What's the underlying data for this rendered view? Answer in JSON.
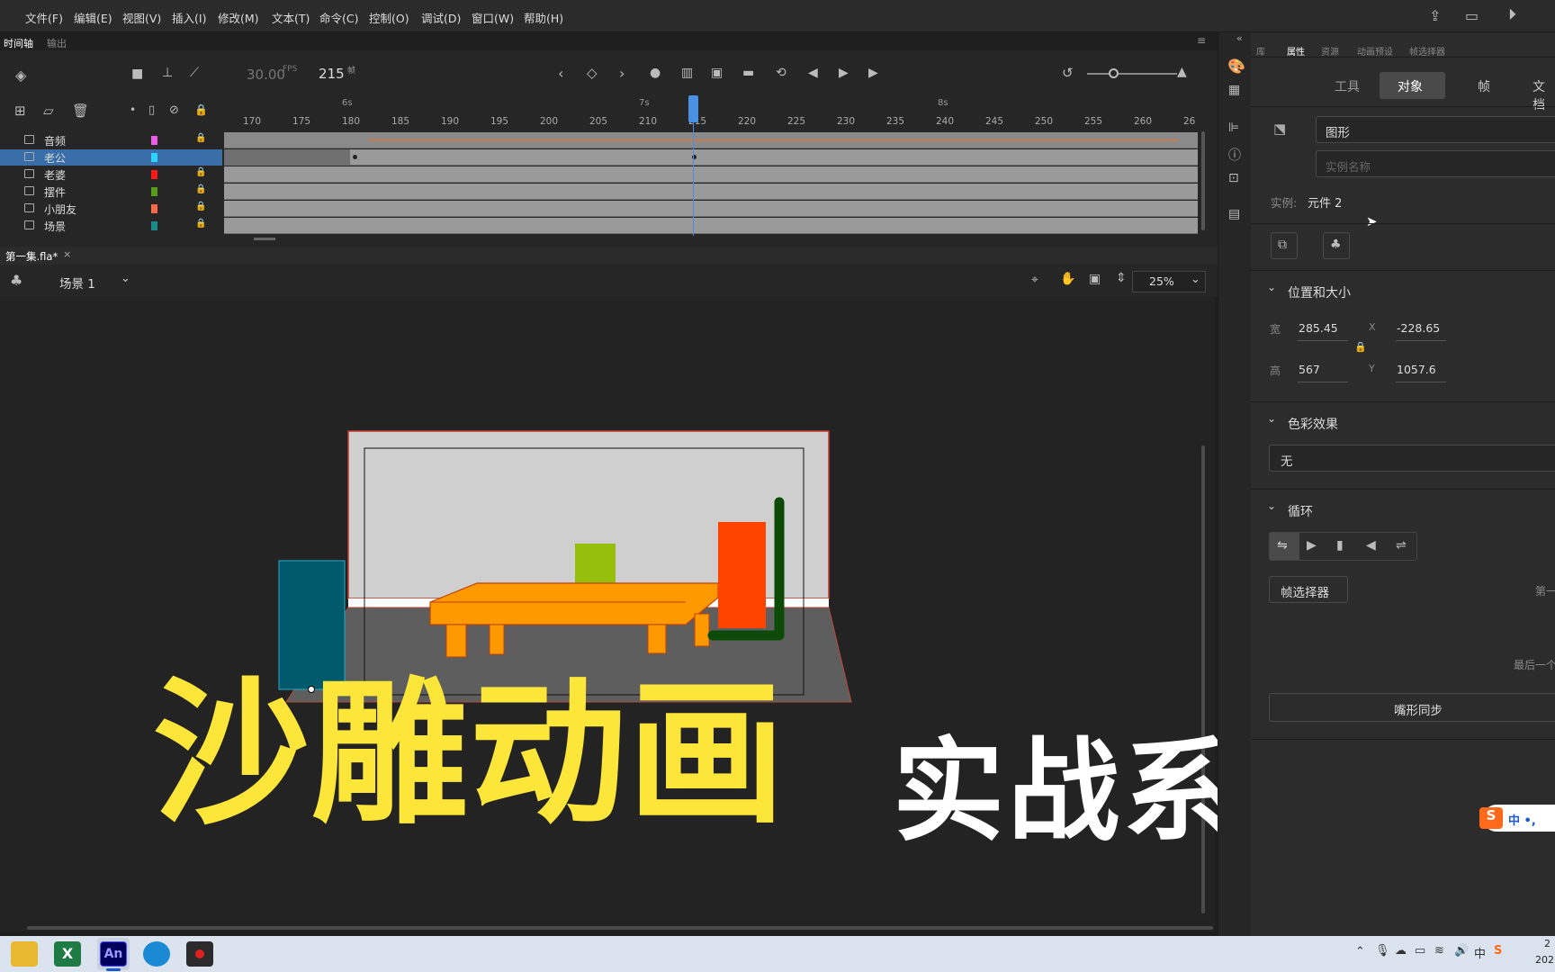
{
  "menu": [
    "文件(F)",
    "编辑(E)",
    "视图(V)",
    "插入(I)",
    "修改(M)",
    "文本(T)",
    "命令(C)",
    "控制(O)",
    "调试(D)",
    "窗口(W)",
    "帮助(H)"
  ],
  "timeline": {
    "tab_active": "时间轴",
    "tab_other": "输出",
    "fps": "30.00",
    "fps_unit": "FPS",
    "frame": "215",
    "frame_unit": "帧",
    "ticks": [
      "170",
      "175",
      "180",
      "185",
      "190",
      "195",
      "200",
      "205",
      "210",
      "215",
      "220",
      "225",
      "230",
      "235",
      "240",
      "245",
      "250",
      "255",
      "260",
      "26"
    ],
    "secs": [
      "6s",
      "7s",
      "8s"
    ],
    "layers": [
      {
        "name": "音频",
        "color": "#e85ce8"
      },
      {
        "name": "老公",
        "color": "#2ad4ff"
      },
      {
        "name": "老婆",
        "color": "#ff1a1a"
      },
      {
        "name": "摆件",
        "color": "#5a9a1a"
      },
      {
        "name": "小朋友",
        "color": "#ff6a4a"
      },
      {
        "name": "场景",
        "color": "#1a8a8a"
      }
    ]
  },
  "document": {
    "tab": "第一集.fla*",
    "scene": "场景 1",
    "zoom": "25%"
  },
  "props": {
    "tabs": [
      "库",
      "属性",
      "资源",
      "动画预设",
      "帧选择器"
    ],
    "subtabs": [
      "工具",
      "对象",
      "帧",
      "文档"
    ],
    "type": "图形",
    "instance_placeholder": "实例名称",
    "instance_label": "实例:",
    "instance_value": "元件 2",
    "pos_title": "位置和大小",
    "w_label": "宽",
    "w": "285.45",
    "x_label": "X",
    "x": "-228.65",
    "h_label": "高",
    "h": "567",
    "y_label": "Y",
    "y": "1057.6",
    "color_title": "色彩效果",
    "color_value": "无",
    "loop_title": "循环",
    "frame_picker": "帧选择器",
    "first_label": "第一",
    "last_label": "最后一个",
    "lip_sync": "嘴形同步"
  },
  "overlay": {
    "big": "沙雕动画",
    "small": "实战系列"
  },
  "ime": {
    "label": "中 •,"
  },
  "taskbar": {
    "clock1": "2",
    "clock2": "202"
  },
  "colors": {
    "accent": "#3a6ea8",
    "title_yellow": "#fde63a",
    "playhead": "#4a90e2"
  }
}
